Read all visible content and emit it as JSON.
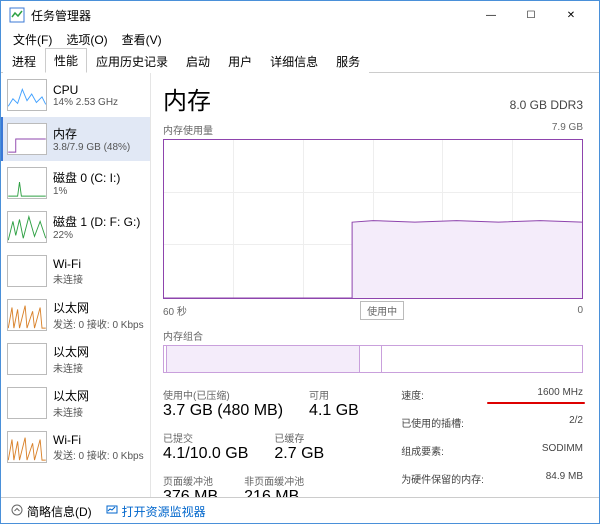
{
  "window": {
    "title": "任务管理器",
    "menus": [
      "文件(F)",
      "选项(O)",
      "查看(V)"
    ],
    "tabs": [
      "进程",
      "性能",
      "应用历史记录",
      "启动",
      "用户",
      "详细信息",
      "服务"
    ],
    "active_tab": 1,
    "winbtn_min": "—",
    "winbtn_max": "☐",
    "winbtn_close": "✕"
  },
  "sidebar": [
    {
      "name": "CPU",
      "sub": "14% 2.53 GHz",
      "color": "#40a0ff",
      "selected": false
    },
    {
      "name": "内存",
      "sub": "3.8/7.9 GB (48%)",
      "color": "#8e44ad",
      "selected": true
    },
    {
      "name": "磁盘 0 (C: I:)",
      "sub": "1%",
      "color": "#2ea043",
      "selected": false
    },
    {
      "name": "磁盘 1 (D: F: G:)",
      "sub": "22%",
      "color": "#2ea043",
      "selected": false
    },
    {
      "name": "Wi-Fi",
      "sub": "未连接",
      "color": "#888",
      "selected": false
    },
    {
      "name": "以太网",
      "sub": "发送: 0 接收: 0 Kbps",
      "color": "#d9822b",
      "selected": false
    },
    {
      "name": "以太网",
      "sub": "未连接",
      "color": "#888",
      "selected": false
    },
    {
      "name": "以太网",
      "sub": "未连接",
      "color": "#888",
      "selected": false
    },
    {
      "name": "Wi-Fi",
      "sub": "发送: 0 接收: 0 Kbps",
      "color": "#d9822b",
      "selected": false
    }
  ],
  "main": {
    "title": "内存",
    "subtitle": "8.0 GB DDR3",
    "chart_label": "内存使用量",
    "chart_max": "7.9 GB",
    "axis_left": "60 秒",
    "axis_right": "0",
    "using_label": "使用中",
    "composition_label": "内存组合",
    "stats_left": [
      {
        "lbl": "使用中(已压缩)",
        "val": "3.7 GB (480 MB)"
      },
      {
        "lbl": "可用",
        "val": "4.1 GB"
      },
      {
        "lbl": "已提交",
        "val": "4.1/10.0 GB"
      },
      {
        "lbl": "已缓存",
        "val": "2.7 GB"
      },
      {
        "lbl": "页面缓冲池",
        "val": "376 MB"
      },
      {
        "lbl": "非页面缓冲池",
        "val": "216 MB"
      }
    ],
    "stats_right": [
      {
        "k": "速度:",
        "v": "1600 MHz",
        "hl": true
      },
      {
        "k": "已使用的插槽:",
        "v": "2/2"
      },
      {
        "k": "组成要素:",
        "v": "SODIMM"
      },
      {
        "k": "为硬件保留的内存:",
        "v": "84.9 MB"
      }
    ]
  },
  "footer": {
    "less": "简略信息(D)",
    "link": "打开资源监视器"
  },
  "chart_data": {
    "type": "area",
    "title": "内存使用量",
    "xlabel": "60 秒",
    "ylabel": "",
    "ylim": [
      0,
      7.9
    ],
    "x_seconds": [
      60,
      55,
      50,
      45,
      40,
      35,
      30,
      25,
      20,
      15,
      10,
      5,
      0
    ],
    "values_gb": [
      0,
      0,
      0,
      0,
      0,
      0,
      3.8,
      3.8,
      3.8,
      3.8,
      3.8,
      3.8,
      3.8
    ]
  }
}
